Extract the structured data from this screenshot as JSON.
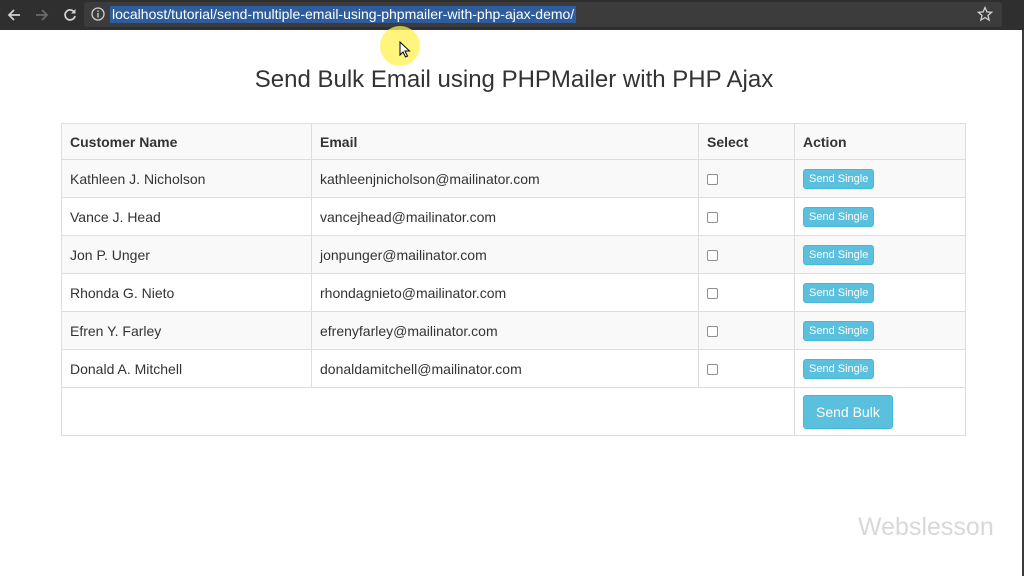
{
  "browser": {
    "url": "localhost/tutorial/send-multiple-email-using-phpmailer-with-php-ajax-demo/"
  },
  "page": {
    "title": "Send Bulk Email using PHPMailer with PHP Ajax"
  },
  "table": {
    "headers": [
      "Customer Name",
      "Email",
      "Select",
      "Action"
    ],
    "rows": [
      {
        "name": "Kathleen J. Nicholson",
        "email": "kathleenjnicholson@mailinator.com",
        "checked": false,
        "action": "Send Single"
      },
      {
        "name": "Vance J. Head",
        "email": "vancejhead@mailinator.com",
        "checked": false,
        "action": "Send Single"
      },
      {
        "name": "Jon P. Unger",
        "email": "jonpunger@mailinator.com",
        "checked": false,
        "action": "Send Single"
      },
      {
        "name": "Rhonda G. Nieto",
        "email": "rhondagnieto@mailinator.com",
        "checked": false,
        "action": "Send Single"
      },
      {
        "name": "Efren Y. Farley",
        "email": "efrenyfarley@mailinator.com",
        "checked": false,
        "action": "Send Single"
      },
      {
        "name": "Donald A. Mitchell",
        "email": "donaldamitchell@mailinator.com",
        "checked": false,
        "action": "Send Single"
      }
    ],
    "bulk_button": "Send Bulk"
  },
  "watermark": "Webslesson",
  "icons": {
    "back": "arrow-left-icon",
    "forward": "arrow-right-icon",
    "reload": "reload-icon",
    "info": "info-icon",
    "bookmark": "star-icon"
  },
  "colors": {
    "button": "#5bc0de",
    "url_highlight": "#2e5d9e",
    "chrome": "#2f2f2f"
  }
}
